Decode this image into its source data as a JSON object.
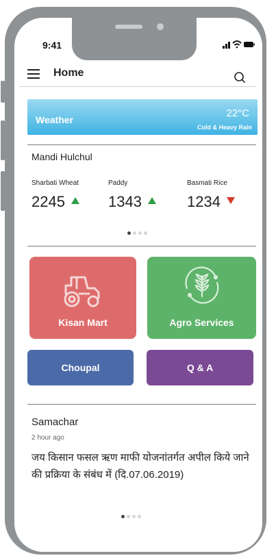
{
  "status_bar": {
    "time": "9:41"
  },
  "header": {
    "title": "Home"
  },
  "weather": {
    "label": "Weather",
    "temperature": "22°C",
    "description": "Cold & Heavy Rain"
  },
  "mandi": {
    "title": "Mandi Hulchul",
    "items": [
      {
        "name": "Sharbati Wheat",
        "price": "2245",
        "trend": "up"
      },
      {
        "name": "Paddy",
        "price": "1343",
        "trend": "up"
      },
      {
        "name": "Basmati Rice",
        "price": "1234",
        "trend": "down"
      }
    ]
  },
  "tiles": {
    "kisan_mart": {
      "label": "Kisan Mart",
      "color": "#de6b6b"
    },
    "agro_services": {
      "label": "Agro Services",
      "color": "#5eb36a"
    },
    "choupal": {
      "label": "Choupal",
      "color": "#4b6aa8"
    },
    "qa": {
      "label": "Q & A",
      "color": "#7a4a95"
    }
  },
  "news": {
    "title": "Samachar",
    "time": "2 hour ago",
    "body": "जय किसान फसल ऋण माफी योजनांतर्गत अपील किये जाने की प्रक्रिया के संबंध में (दि.07.06.2019)"
  },
  "colors": {
    "accent_up": "#2e9e44",
    "accent_down": "#d43a2c",
    "weather_start": "#9ad9f1",
    "weather_end": "#3fb3e3"
  }
}
